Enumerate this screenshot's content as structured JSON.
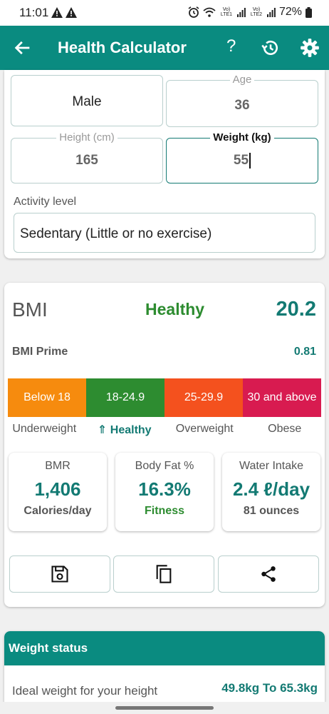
{
  "status_bar": {
    "time": "11:01",
    "net1": "Vo) LTE1",
    "net2": "Vo) LTE2",
    "battery": "72%"
  },
  "app_bar": {
    "title": "Health Calculator",
    "help_icon": "question-mark",
    "history_icon": "history-icon",
    "settings_icon": "gear-icon"
  },
  "inputs": {
    "gender": "Male",
    "age_label": "Age",
    "age": "36",
    "height_label": "Height (cm)",
    "height": "165",
    "weight_label": "Weight (kg)",
    "weight": "55",
    "activity_label": "Activity level",
    "activity": "Sedentary (Little or no exercise)"
  },
  "bmi": {
    "label": "BMI",
    "status": "Healthy",
    "value": "20.2",
    "prime_label": "BMI Prime",
    "prime_value": "0.81",
    "scale": [
      {
        "range": "Below 18",
        "name": "Underweight",
        "color": "#f68b0e"
      },
      {
        "range": "18-24.9",
        "name": "⇑ Healthy",
        "color": "#2d8c30"
      },
      {
        "range": "25-29.9",
        "name": "Overweight",
        "color": "#f4511e"
      },
      {
        "range": "30 and above",
        "name": "Obese",
        "color": "#d81b50"
      }
    ],
    "active_index": 1
  },
  "stats": {
    "bmr": {
      "title": "BMR",
      "value": "1,406",
      "sub": "Calories/day"
    },
    "fat": {
      "title": "Body Fat %",
      "value": "16.3%",
      "sub": "Fitness"
    },
    "water": {
      "title": "Water Intake",
      "value": "2.4 ℓ/day",
      "sub": "81 ounces"
    }
  },
  "weight_status": {
    "title": "Weight status",
    "ideal_label": "Ideal weight for your height",
    "ideal_value": "49.8kg To 65.3kg"
  },
  "colors": {
    "primary": "#0a8b80",
    "accent": "#137a73",
    "healthy": "#2d8c30"
  }
}
